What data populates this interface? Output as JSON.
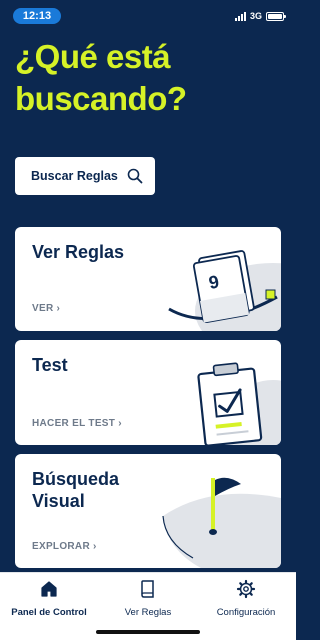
{
  "status_bar": {
    "time": "12:13",
    "network": "3G"
  },
  "headline": "¿Qué está buscando?",
  "search": {
    "label": "Buscar Reglas",
    "icon": "search-icon"
  },
  "cards": [
    {
      "title": "Ver Reglas",
      "action": "VER ›",
      "icon": "rules-book-icon"
    },
    {
      "title": "Test",
      "action": "HACER EL TEST ›",
      "icon": "clipboard-check-icon"
    },
    {
      "title": "Búsqueda Visual",
      "action": "EXPLORAR ›",
      "icon": "golf-flag-icon"
    }
  ],
  "rules_page_number": "9",
  "tabs": [
    {
      "label": "Panel de Control",
      "icon": "home-icon",
      "active": true
    },
    {
      "label": "Ver Reglas",
      "icon": "book-icon",
      "active": false
    },
    {
      "label": "Configuración",
      "icon": "gear-icon",
      "active": false
    }
  ],
  "colors": {
    "navy": "#0c2850",
    "lime": "#d6f227",
    "accent_blue": "#1a7ad9"
  }
}
